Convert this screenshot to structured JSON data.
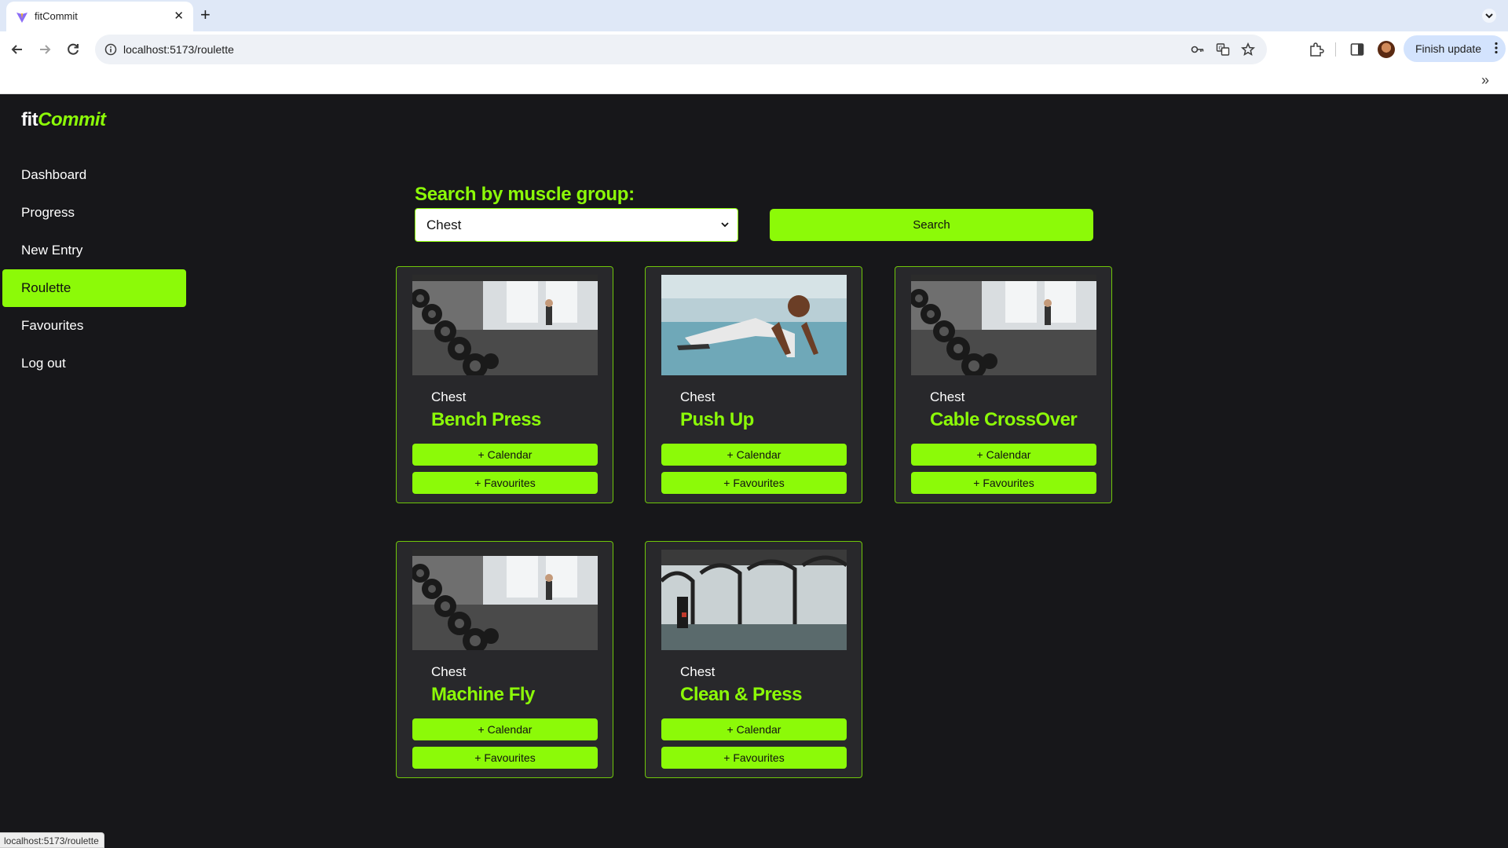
{
  "browser": {
    "tab_title": "fitCommit",
    "url": "localhost:5173/roulette",
    "finish_update_label": "Finish update",
    "new_tab_glyph": "+",
    "close_glyph": "✕",
    "more_glyph": "»",
    "status_text": "localhost:5173/roulette",
    "icons": [
      "vite-favicon",
      "tab-search-icon",
      "back-icon",
      "forward-icon",
      "reload-icon",
      "site-info-icon",
      "password-key-icon",
      "translate-icon",
      "star-icon",
      "extensions-icon",
      "side-panel-icon",
      "profile-avatar",
      "kebab-menu-icon"
    ]
  },
  "app": {
    "logo_prefix": "fit",
    "logo_suffix": "Commit",
    "accent_color": "#8cfa08",
    "background_color": "#17171a",
    "nav": [
      {
        "label": "Dashboard",
        "active": false
      },
      {
        "label": "Progress",
        "active": false
      },
      {
        "label": "New Entry",
        "active": false
      },
      {
        "label": "Roulette",
        "active": true
      },
      {
        "label": "Favourites",
        "active": false
      },
      {
        "label": "Log out",
        "active": false
      }
    ],
    "search": {
      "heading": "Search by muscle group:",
      "selected_value": "Chest",
      "button_label": "Search"
    },
    "cards": [
      {
        "category": "Chest",
        "title": "Bench Press",
        "image": "gym-dumbbells-photo",
        "calendar_label": "+ Calendar",
        "favourites_label": "+ Favourites"
      },
      {
        "category": "Chest",
        "title": "Push Up",
        "image": "man-push-up-photo",
        "calendar_label": "+ Calendar",
        "favourites_label": "+ Favourites"
      },
      {
        "category": "Chest",
        "title": "Cable CrossOver",
        "image": "gym-dumbbells-photo",
        "calendar_label": "+ Calendar",
        "favourites_label": "+ Favourites"
      },
      {
        "category": "Chest",
        "title": "Machine Fly",
        "image": "gym-dumbbells-photo",
        "calendar_label": "+ Calendar",
        "favourites_label": "+ Favourites"
      },
      {
        "category": "Chest",
        "title": "Clean & Press",
        "image": "treadmills-photo",
        "calendar_label": "+ Calendar",
        "favourites_label": "+ Favourites"
      }
    ]
  }
}
